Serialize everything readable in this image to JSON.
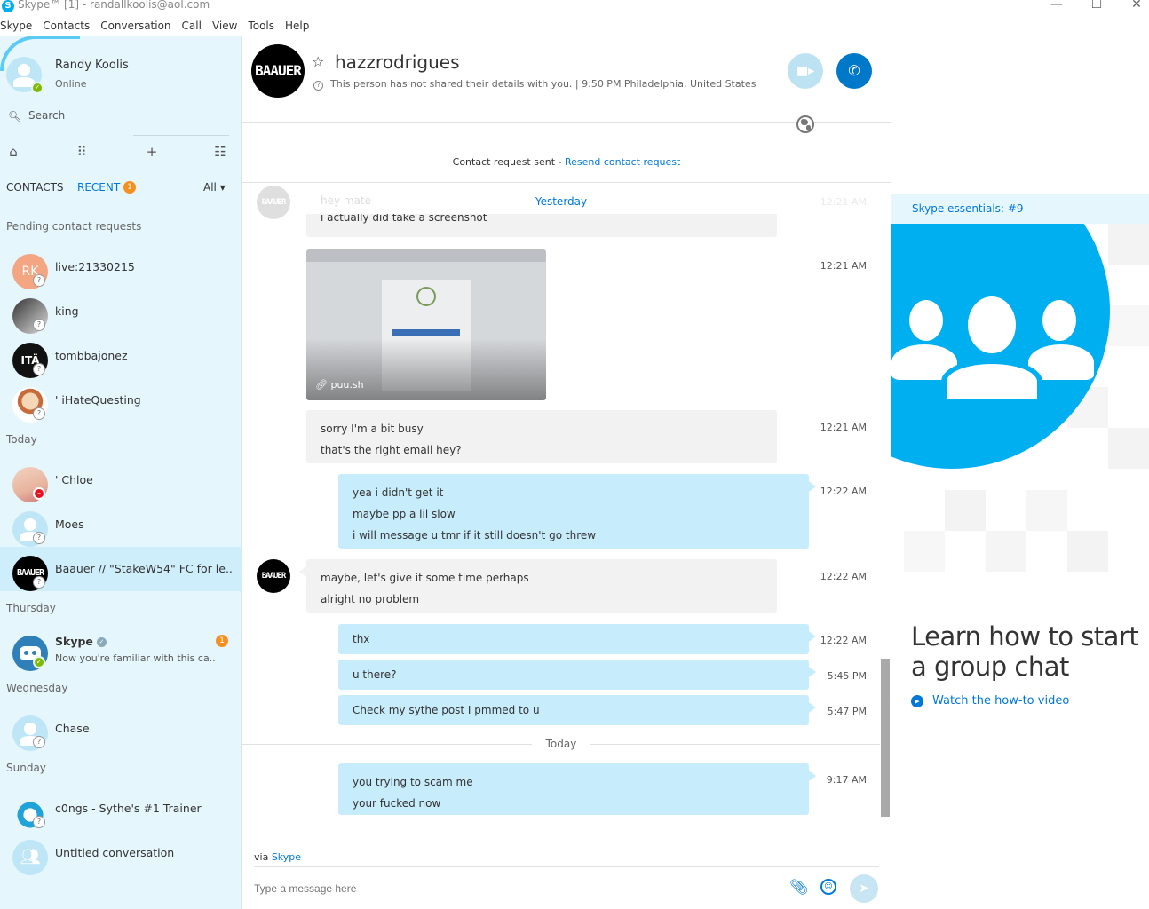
{
  "window": {
    "title": "Skype™ [1] - randallkoolis@aol.com",
    "minimize": "—",
    "maximize": "☐",
    "close": "✕"
  },
  "menu": [
    "Skype",
    "Contacts",
    "Conversation",
    "Call",
    "View",
    "Tools",
    "Help"
  ],
  "profile": {
    "name": "Randy Koolis",
    "status": "Online"
  },
  "search": {
    "label": "Search"
  },
  "tabs": {
    "contacts": "CONTACTS",
    "recent": "RECENT",
    "recent_badge": "1",
    "filter": "All"
  },
  "sections": {
    "pending": "Pending contact requests",
    "today": "Today",
    "thursday": "Thursday",
    "wednesday": "Wednesday",
    "sunday": "Sunday"
  },
  "recent": [
    {
      "name": "live:21330215",
      "initials": "RK"
    },
    {
      "name": "king"
    },
    {
      "name": "tombbajonez",
      "logo": "ITÄ"
    },
    {
      "name": "' iHateQuesting"
    },
    {
      "name": "' Chloe"
    },
    {
      "name": "Moes"
    },
    {
      "name": "Baauer  // \"StakeW54\" FC for le...",
      "logo": "BAAUER"
    },
    {
      "name": "Skype",
      "sub": "Now you're familiar with this ca...",
      "badge": "1"
    },
    {
      "name": "Chase"
    },
    {
      "name": "c0ngs - Sythe's #1 Trainer"
    },
    {
      "name": "Untitled conversation"
    }
  ],
  "conversation": {
    "logo": "BAAUER",
    "name": "hazzrodrigues",
    "info": "This person has not shared their details with you.  |  9:50 PM Philadelphia, United States",
    "request_text": "Contact request sent - ",
    "request_link": "Resend contact request",
    "day_yesterday": "Yesterday",
    "day_today": "Today",
    "faded_msg": "hey mate",
    "faded_time": "12:21 AM",
    "partial_msg": "i actually did take a screenshot",
    "image_source": "puu.sh",
    "image_time": "12:21 AM",
    "messages": [
      {
        "lines": [
          "sorry I'm a bit busy",
          "that's the right email hey?"
        ],
        "time": "12:21 AM"
      },
      {
        "lines": [
          "yea i didn't get it",
          "maybe pp a lil slow",
          "i will message u tmr if it still doesn't go threw"
        ],
        "time": "12:22 AM"
      },
      {
        "lines": [
          "maybe, let's give it some time perhaps",
          "alright no problem"
        ],
        "time": "12:22 AM"
      },
      {
        "lines": [
          "thx"
        ],
        "time": "12:22 AM"
      },
      {
        "lines": [
          "u there?"
        ],
        "time": "5:45 PM"
      },
      {
        "lines": [
          "Check my sythe post I pmmed to u"
        ],
        "time": "5:47 PM"
      },
      {
        "lines": [
          "you trying to scam me",
          "your fucked now"
        ],
        "time": "9:17 AM"
      }
    ],
    "via_prefix": "via ",
    "via_link": "Skype",
    "input_placeholder": "Type a message here"
  },
  "essentials": {
    "label": "Skype essentials: #9",
    "heading_line1": "Learn how to start",
    "heading_line2": "a group chat",
    "link": "Watch the how-to video"
  },
  "colors": {
    "accent": "#00aff0",
    "link": "#0078d7",
    "badge": "#f78f1e",
    "online": "#7fba00"
  }
}
